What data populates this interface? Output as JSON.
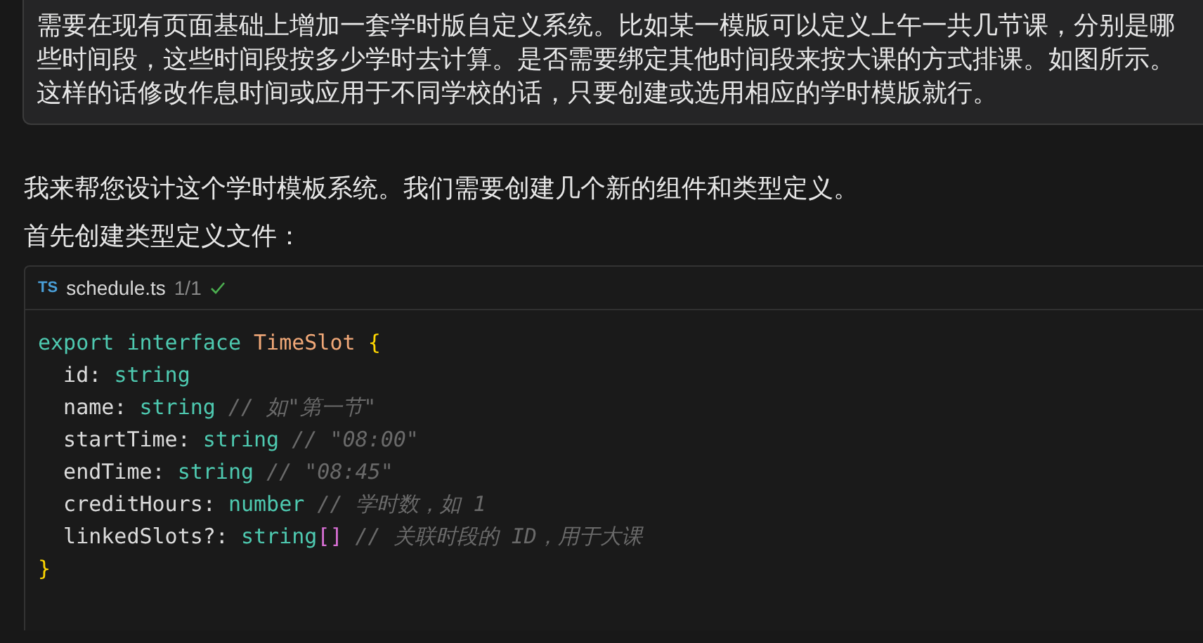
{
  "user_message": {
    "text": "需要在现有页面基础上增加一套学时版自定义系统。比如某一模版可以定义上午一共几节课，分别是哪些时间段，这些时间段按多少学时去计算。是否需要绑定其他时间段来按大课的方式排课。如图所示。这样的话修改作息时间或应用于不同学校的话，只要创建或选用相应的学时模版就行。"
  },
  "response": {
    "paragraphs": [
      "我来帮您设计这个学时模板系统。我们需要创建几个新的组件和类型定义。",
      "首先创建类型定义文件："
    ],
    "code_block": {
      "language_badge": "TS",
      "filename": "schedule.ts",
      "count": "1/1",
      "applied": true,
      "lines": [
        [
          {
            "text": "export interface ",
            "kind": "keyword"
          },
          {
            "text": "TimeSlot ",
            "kind": "class"
          },
          {
            "text": "{",
            "kind": "brace"
          }
        ],
        [
          {
            "text": "  id: ",
            "kind": "prop"
          },
          {
            "text": "string",
            "kind": "type"
          }
        ],
        [
          {
            "text": "  name: ",
            "kind": "prop"
          },
          {
            "text": "string ",
            "kind": "type"
          },
          {
            "text": "// 如\"第一节\"",
            "kind": "comment"
          }
        ],
        [
          {
            "text": "  startTime: ",
            "kind": "prop"
          },
          {
            "text": "string ",
            "kind": "type"
          },
          {
            "text": "// \"08:00\"",
            "kind": "comment"
          }
        ],
        [
          {
            "text": "  endTime: ",
            "kind": "prop"
          },
          {
            "text": "string ",
            "kind": "type"
          },
          {
            "text": "// \"08:45\"",
            "kind": "comment"
          }
        ],
        [
          {
            "text": "  creditHours: ",
            "kind": "prop"
          },
          {
            "text": "number ",
            "kind": "type"
          },
          {
            "text": "// 学时数，如 1",
            "kind": "comment"
          }
        ],
        [
          {
            "text": "  linkedSlots?: ",
            "kind": "prop"
          },
          {
            "text": "string",
            "kind": "type"
          },
          {
            "text": "[]",
            "kind": "bracket"
          },
          {
            "text": " // 关联时段的 ID，用于大课",
            "kind": "comment"
          }
        ],
        [
          {
            "text": "}",
            "kind": "brace"
          }
        ]
      ]
    }
  }
}
